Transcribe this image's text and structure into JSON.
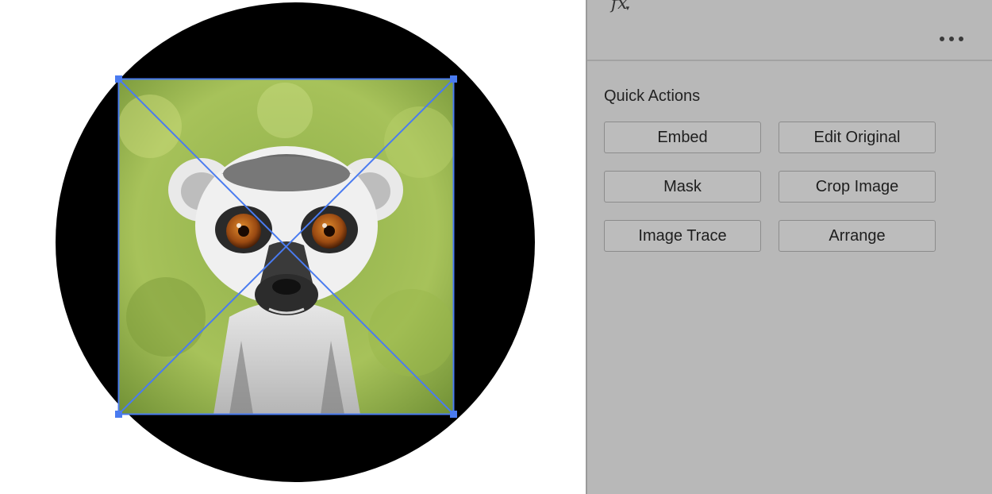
{
  "panel": {
    "fx_icon": "fx",
    "more_icon": "•••",
    "quick_actions": {
      "title": "Quick Actions",
      "buttons": [
        {
          "label": "Embed"
        },
        {
          "label": "Edit Original"
        },
        {
          "label": "Mask"
        },
        {
          "label": "Crop Image"
        },
        {
          "label": "Image Trace"
        },
        {
          "label": "Arrange"
        }
      ]
    }
  },
  "colors": {
    "selection": "#4a7bf0",
    "panel_bg": "#b8b8b8",
    "circle": "#000000"
  }
}
